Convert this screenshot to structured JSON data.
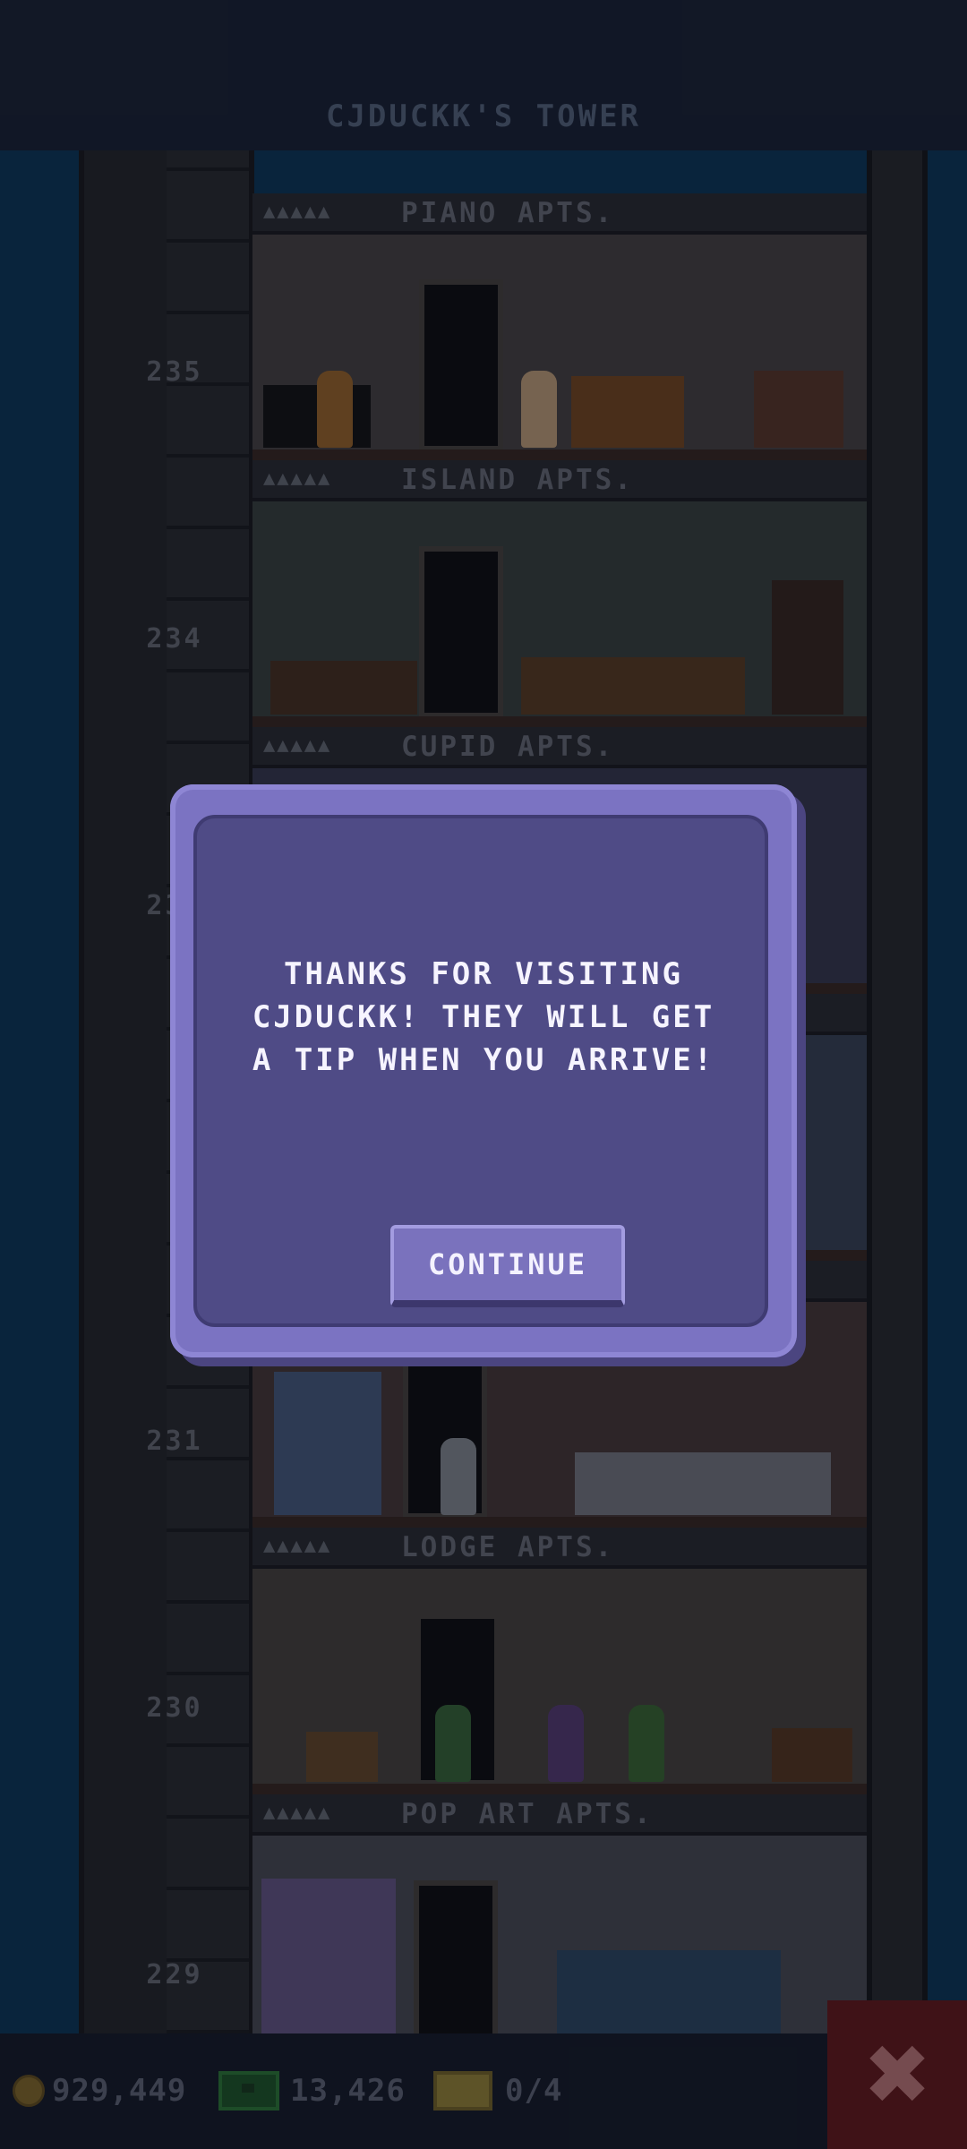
{
  "header": {
    "tower_title": "CJDUCKK'S TOWER"
  },
  "floors": [
    {
      "number": "235",
      "name": "PIANO APTS.",
      "dots": "▲▲▲▲▲"
    },
    {
      "number": "234",
      "name": "ISLAND APTS.",
      "dots": "▲▲▲▲▲"
    },
    {
      "number": "233",
      "name": "CUPID APTS.",
      "dots": "▲▲▲▲▲"
    },
    {
      "number": "231",
      "name": "",
      "dots": ""
    },
    {
      "number": "230",
      "name": "LODGE APTS.",
      "dots": "▲▲▲▲▲"
    },
    {
      "number": "229",
      "name": "POP ART APTS.",
      "dots": "▲▲▲▲▲"
    }
  ],
  "modal": {
    "message": "THANKS FOR VISITING CJDUCKK! THEY WILL GET A TIP WHEN YOU ARRIVE!",
    "continue_label": "CONTINUE"
  },
  "bottom_bar": {
    "coins": "929,449",
    "bux": "13,426",
    "tickets": "0/4"
  },
  "icons": {
    "coin": "coin-icon",
    "bux": "bux-icon",
    "ticket": "ticket-icon",
    "close": "close-icon"
  },
  "colors": {
    "modal_border": "#7b73c2",
    "modal_body": "#4f4b86",
    "close_button": "#6a1b1d"
  }
}
